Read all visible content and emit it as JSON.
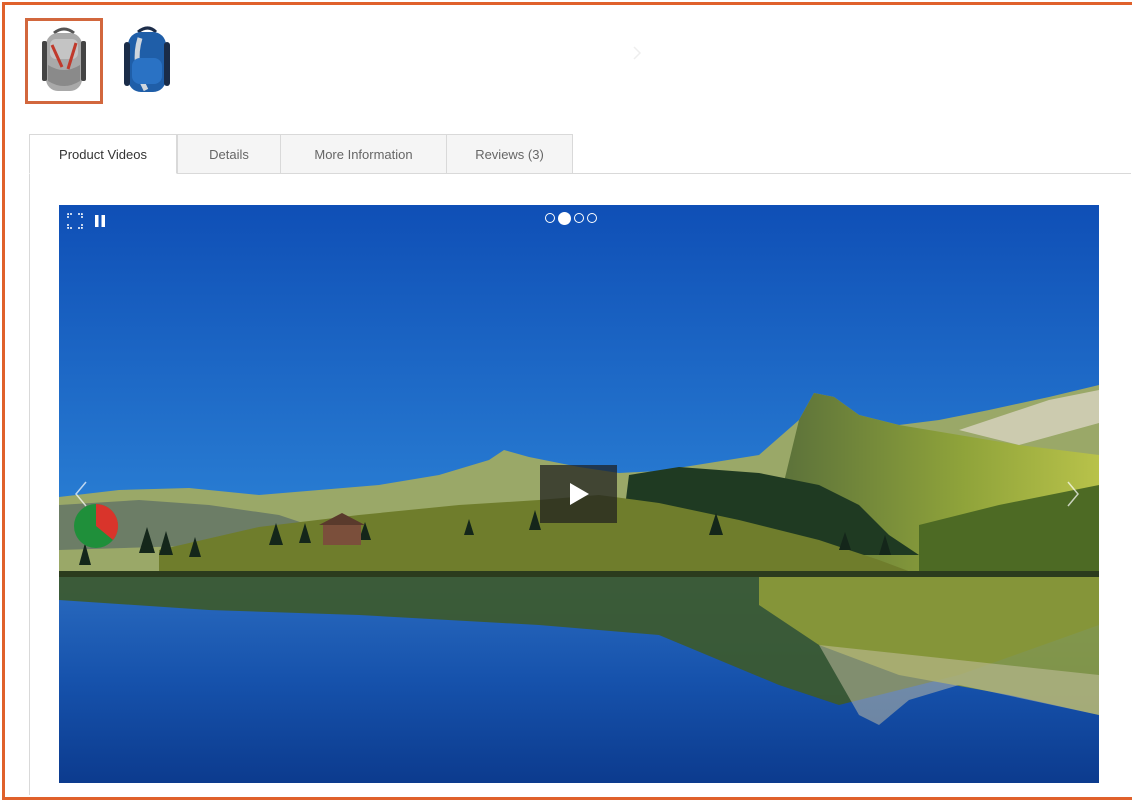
{
  "thumbnails": [
    {
      "icon": "gray-backpack-icon",
      "selected": true
    },
    {
      "icon": "blue-backpack-icon",
      "selected": false
    }
  ],
  "tabs": [
    {
      "label": "Product Videos",
      "active": true
    },
    {
      "label": "Details",
      "active": false
    },
    {
      "label": "More Information",
      "active": false
    },
    {
      "label": "Reviews (3)",
      "active": false
    }
  ],
  "player": {
    "slides": 4,
    "active_slide": 2,
    "controls": [
      "fullscreen-icon",
      "pause-icon",
      "play-icon",
      "prev-arrow-icon",
      "next-arrow-icon"
    ]
  },
  "colors": {
    "highlight": "#e0612b",
    "sky": "#1557b8",
    "tab_border": "#d9d9d9"
  }
}
